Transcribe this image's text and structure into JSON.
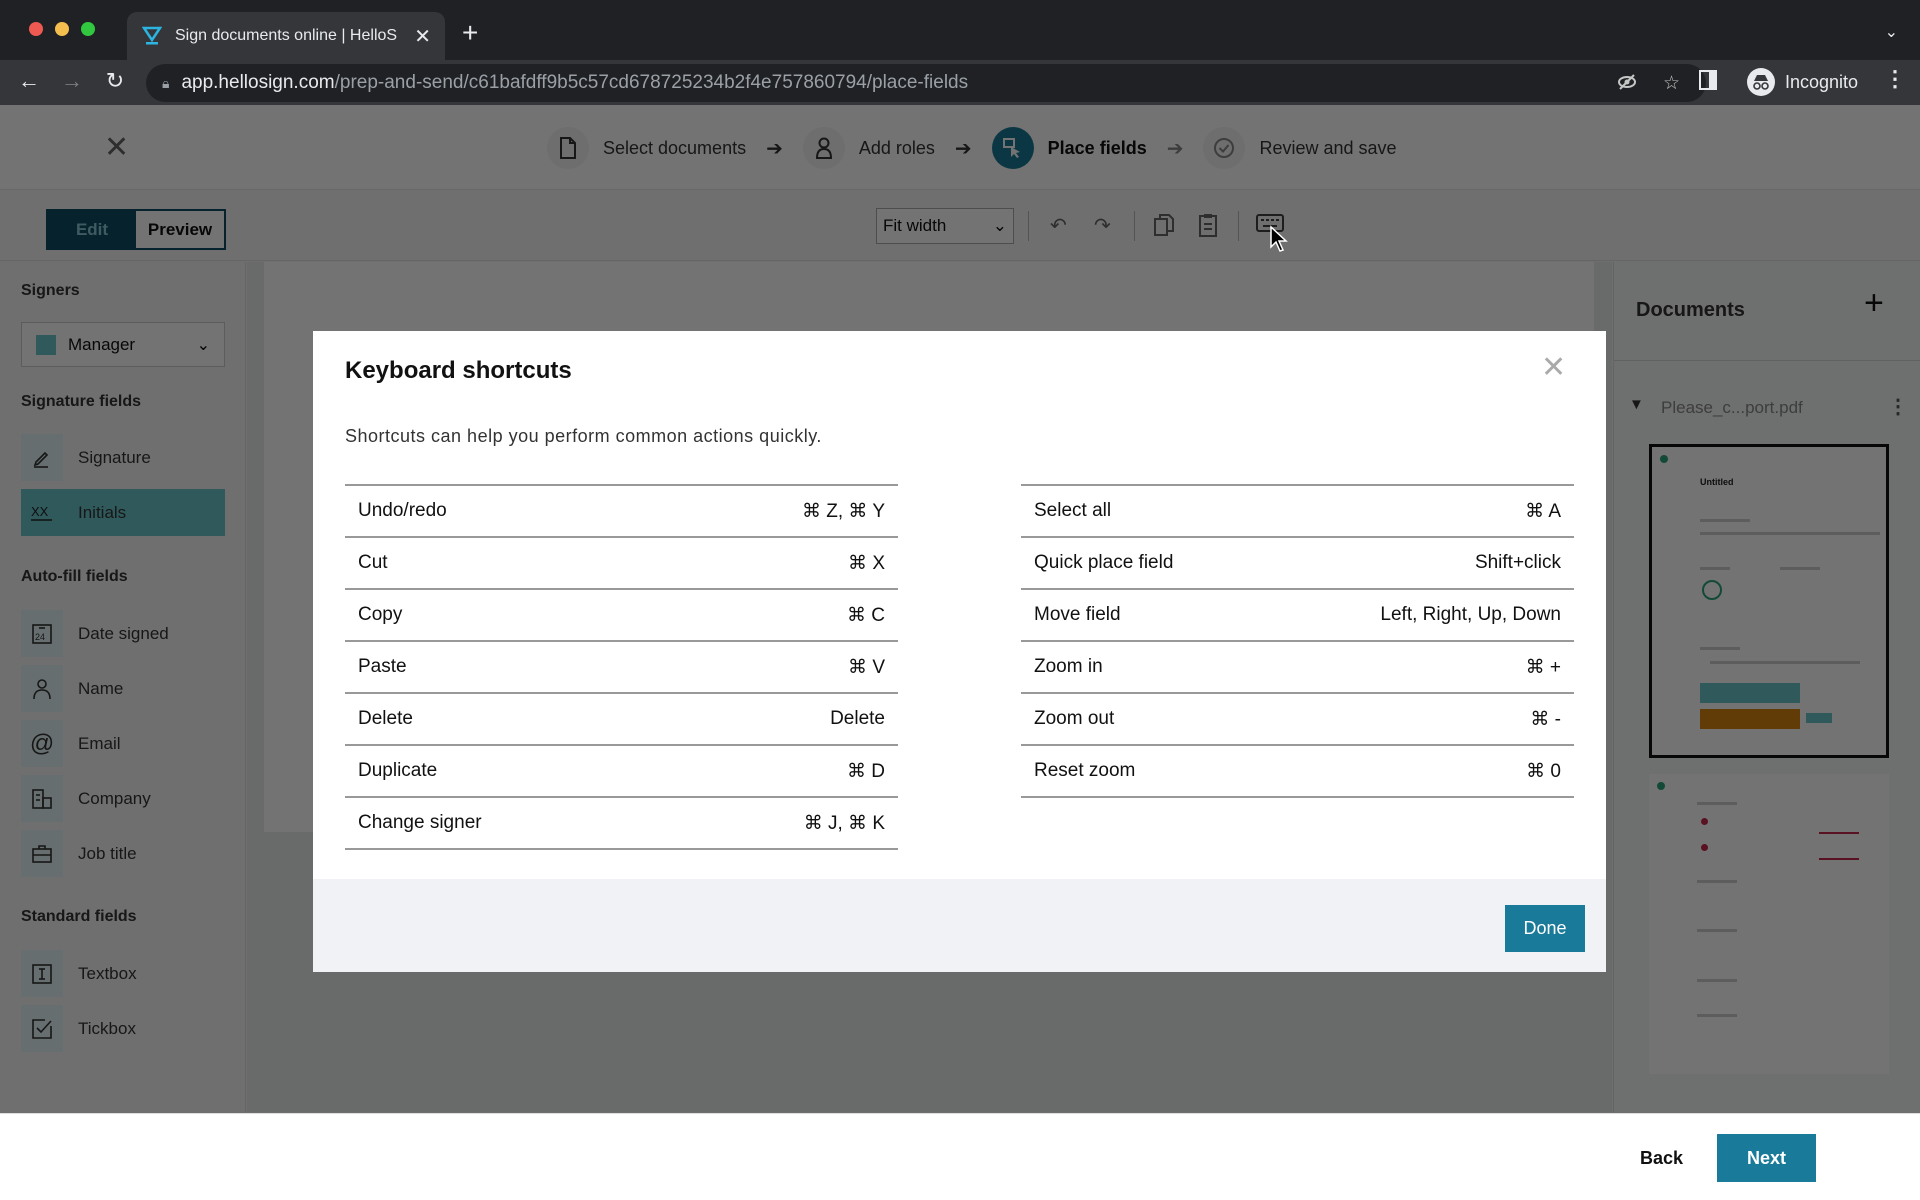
{
  "browser": {
    "tab_title": "Sign documents online | HelloS",
    "url_host": "app.hellosign.com",
    "url_path": "/prep-and-send/c61bafdff9b5c57cd678725234b2f4e757860794/place-fields",
    "profile_label": "Incognito"
  },
  "stepper": {
    "steps": [
      {
        "label": "Select documents",
        "icon": "document-icon",
        "state": "done"
      },
      {
        "label": "Add roles",
        "icon": "person-icon",
        "state": "done"
      },
      {
        "label": "Place fields",
        "icon": "place-field-icon",
        "state": "active"
      },
      {
        "label": "Review and save",
        "icon": "check-circle-icon",
        "state": "upcoming"
      }
    ]
  },
  "editor_toolbar": {
    "edit_label": "Edit",
    "preview_label": "Preview",
    "zoom_value": "Fit width"
  },
  "left_panel": {
    "signers_title": "Signers",
    "selected_signer": "Manager",
    "signer_color": "#6cc5cc",
    "signature_title": "Signature fields",
    "signature_fields": [
      {
        "label": "Signature",
        "icon": "pen-icon",
        "selected": false
      },
      {
        "label": "Initials",
        "icon": "initials-icon",
        "selected": true
      }
    ],
    "autofill_title": "Auto-fill fields",
    "autofill_fields": [
      {
        "label": "Date signed",
        "icon": "calendar-icon"
      },
      {
        "label": "Name",
        "icon": "person-icon"
      },
      {
        "label": "Email",
        "icon": "at-icon"
      },
      {
        "label": "Company",
        "icon": "building-icon"
      },
      {
        "label": "Job title",
        "icon": "briefcase-icon"
      }
    ],
    "standard_title": "Standard fields",
    "standard_fields": [
      {
        "label": "Textbox",
        "icon": "textbox-icon"
      },
      {
        "label": "Tickbox",
        "icon": "checkbox-icon"
      }
    ]
  },
  "right_panel": {
    "title": "Documents",
    "document_name": "Please_c...port.pdf",
    "thumb1_heading": "Untitled"
  },
  "modal": {
    "title": "Keyboard shortcuts",
    "description": "Shortcuts can help you perform common actions quickly.",
    "left_shortcuts": [
      {
        "action": "Undo/redo",
        "keys": "⌘ Z, ⌘ Y"
      },
      {
        "action": "Cut",
        "keys": "⌘ X"
      },
      {
        "action": "Copy",
        "keys": "⌘ C"
      },
      {
        "action": "Paste",
        "keys": "⌘ V"
      },
      {
        "action": "Delete",
        "keys": "Delete"
      },
      {
        "action": "Duplicate",
        "keys": "⌘ D"
      },
      {
        "action": "Change signer",
        "keys": "⌘ J, ⌘ K"
      }
    ],
    "right_shortcuts": [
      {
        "action": "Select all",
        "keys": "⌘ A"
      },
      {
        "action": "Quick place field",
        "keys": "Shift+click"
      },
      {
        "action": "Move field",
        "keys": "Left, Right, Up, Down"
      },
      {
        "action": "Zoom in",
        "keys": "⌘ +"
      },
      {
        "action": "Zoom out",
        "keys": "⌘ -"
      },
      {
        "action": "Reset zoom",
        "keys": "⌘ 0"
      }
    ],
    "done_label": "Done"
  },
  "footer": {
    "back_label": "Back",
    "next_label": "Next"
  },
  "colors": {
    "accent": "#1a7a99",
    "edit_active": "#0f4d63",
    "signer": "#6cc5cc"
  }
}
